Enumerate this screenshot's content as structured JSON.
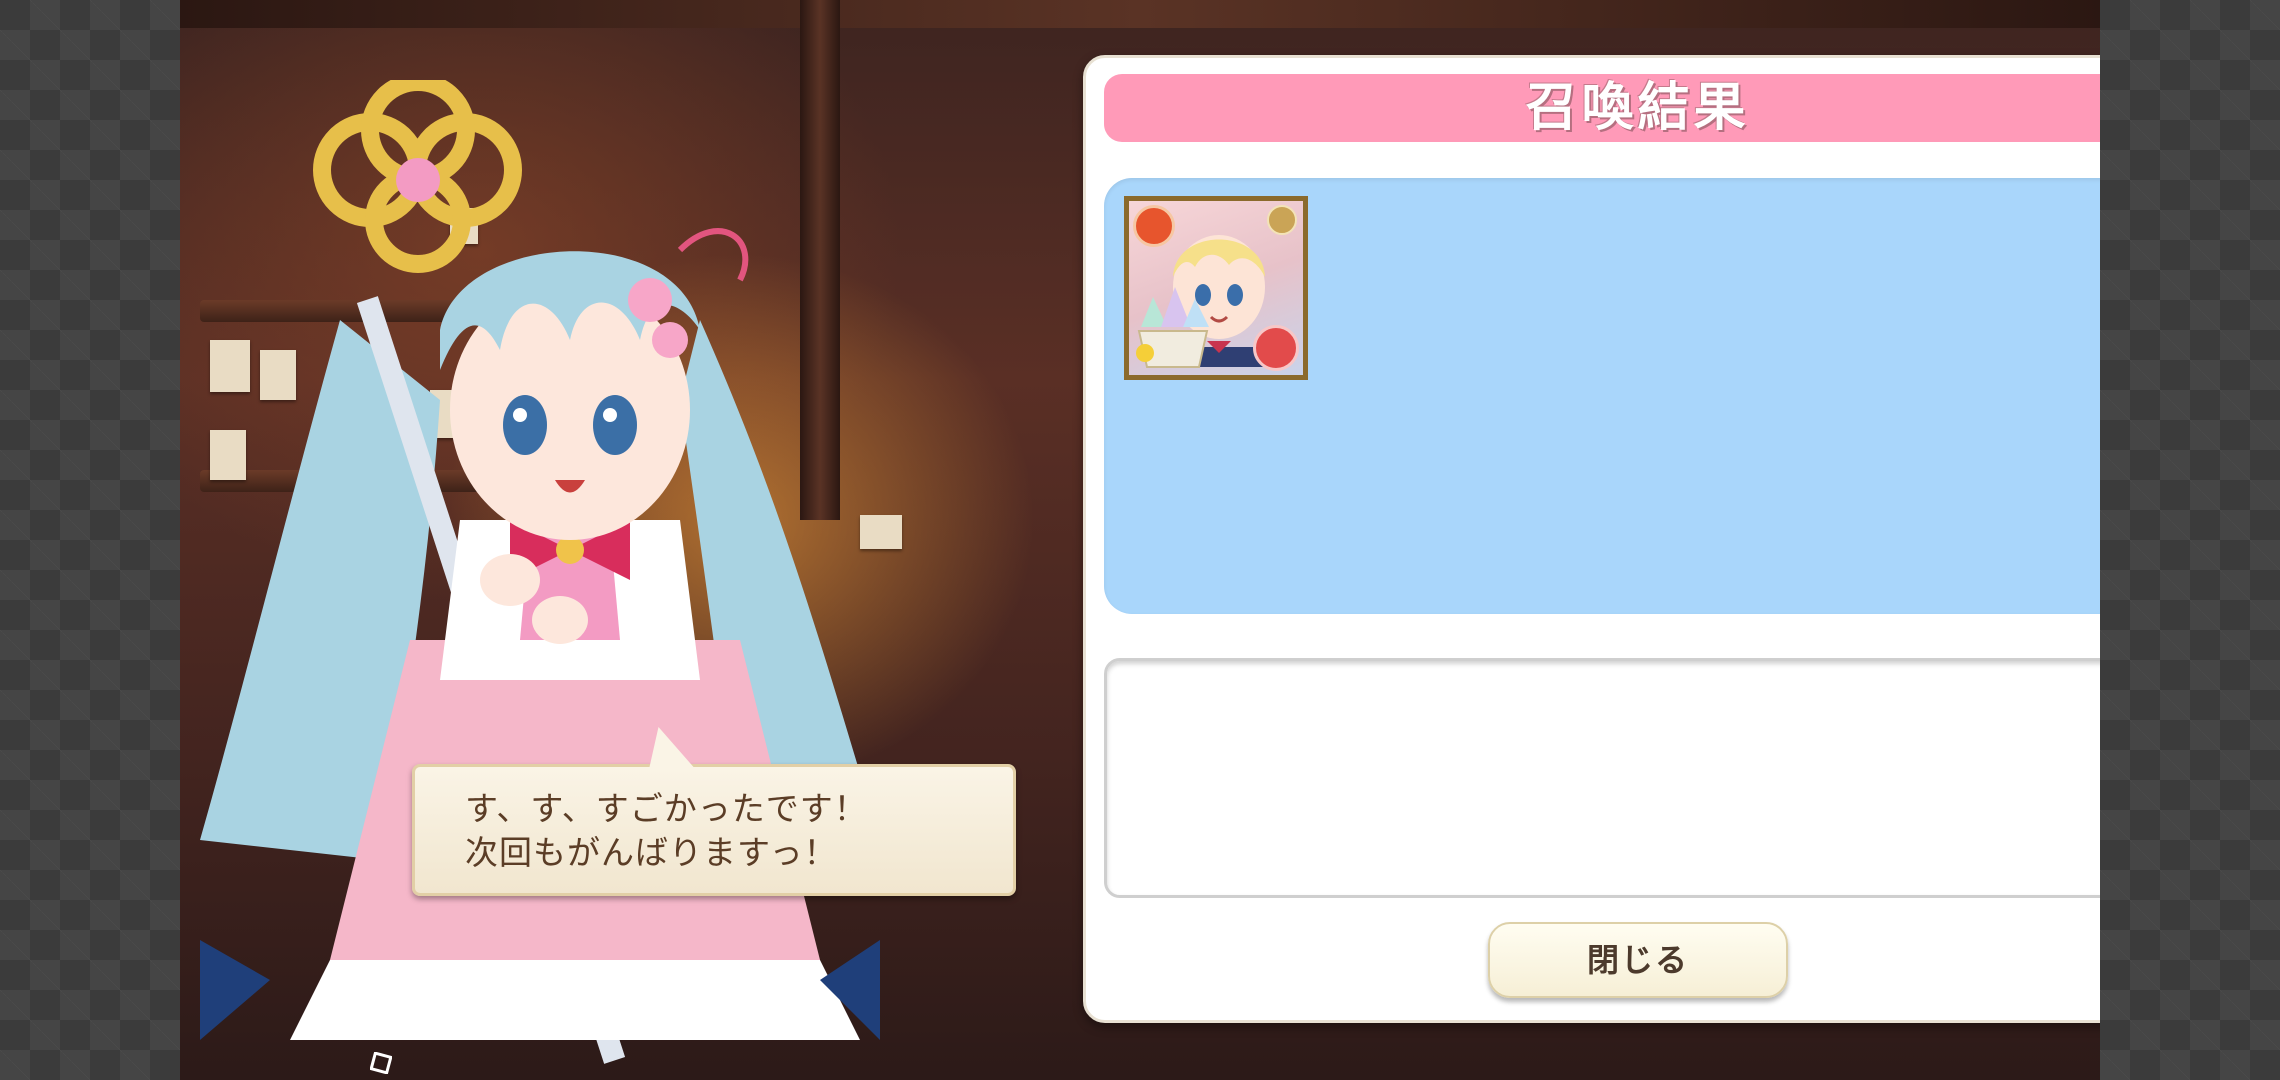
{
  "panel": {
    "title": "召喚結果"
  },
  "result": {
    "items": [
      {
        "icon": "character-portrait-icon",
        "class_icon": "class-badge-icon",
        "element_icon": "fire-element-icon",
        "rank_icon": "rank-badge-icon",
        "item_overlay": "crystal-icon"
      }
    ]
  },
  "speech": {
    "line1": "す、す、すごかったです！",
    "line2": "次回もがんばりますっ！"
  },
  "buttons": {
    "close_label": "閉じる"
  },
  "colors": {
    "header_pink": "#ff9ab8",
    "result_bg": "#a9d6fb",
    "panel_bg": "#ffffff",
    "button_bg": "#f6efd6",
    "text_brown": "#5b3d26"
  }
}
